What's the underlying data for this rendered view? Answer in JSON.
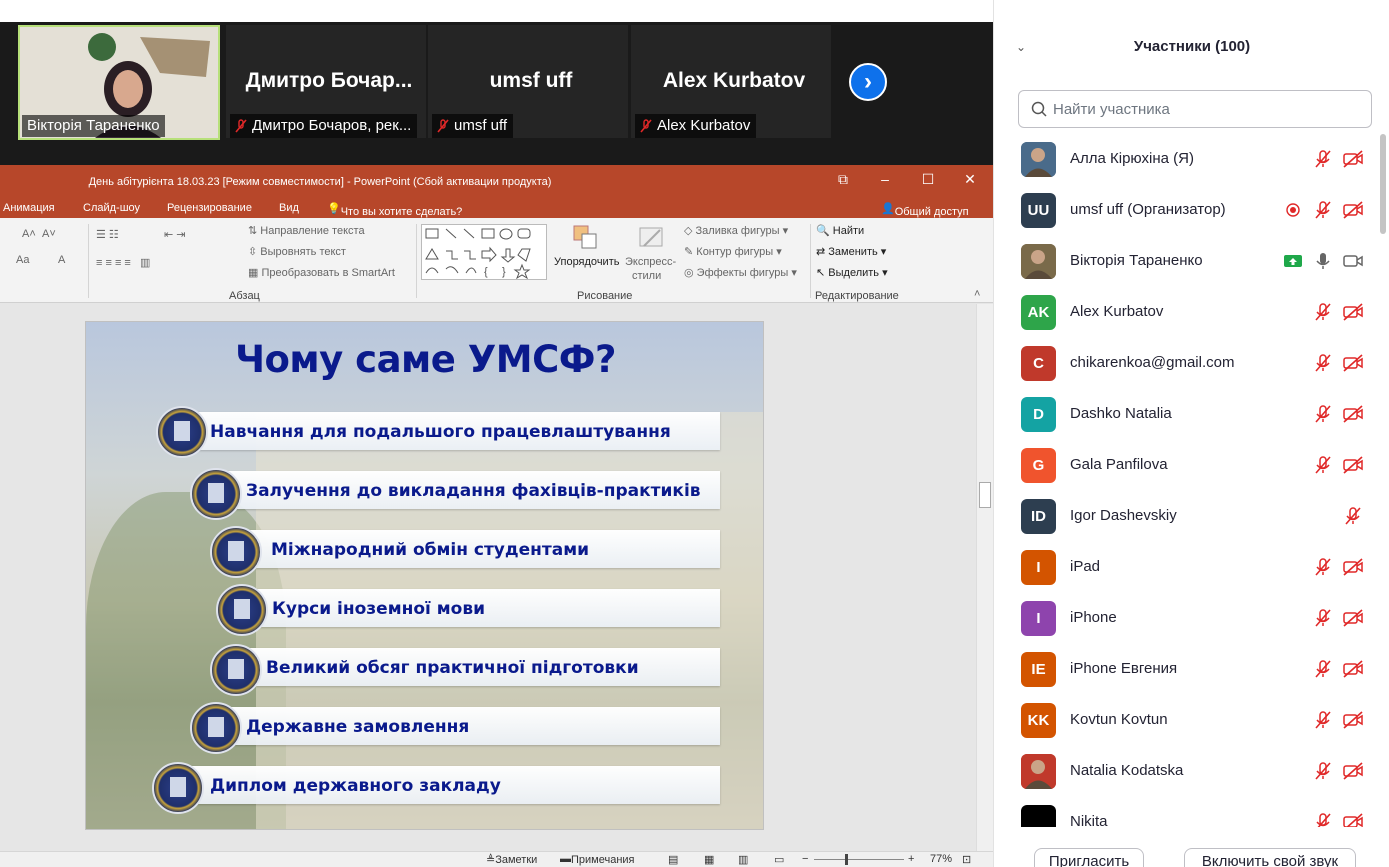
{
  "window": {
    "minimize": "—",
    "maximize": "☐",
    "close": "✕"
  },
  "zoom": {
    "self_label": "Вікторія Тараненко",
    "tiles": [
      {
        "name": "Дмитро Бочар...",
        "label": "Дмитро Бочаров, рек..."
      },
      {
        "name": "umsf uff",
        "label": "umsf uff"
      },
      {
        "name": "Alex Kurbatov",
        "label": "Alex Kurbatov"
      }
    ],
    "next_glyph": "›"
  },
  "ppt": {
    "title": "День абітурієнта 18.03.23 [Режим совместимости] - PowerPoint (Сбой активации продукта)",
    "tabs": [
      "Анимация",
      "Слайд-шоу",
      "Рецензирование",
      "Вид",
      "Что вы хотите сделать?",
      "Общий доступ"
    ],
    "ribbon": {
      "text_dir": "Направление текста",
      "align_text": "Выровнять текст",
      "smartart": "Преобразовать в SmartArt",
      "paragraph": "Абзац",
      "arrange": "Упорядочить",
      "quick_styles_1": "Экспресс-",
      "quick_styles_2": "стили",
      "fill": "Заливка фигуры",
      "outline": "Контур фигуры",
      "effects": "Эффекты фигуры",
      "drawing": "Рисование",
      "find": "Найти",
      "replace": "Заменить",
      "select": "Выделить",
      "editing": "Редактирование",
      "font_grow": "A˄",
      "font_shrink": "A˅",
      "case": "Aa",
      "font_color": "A"
    },
    "status": {
      "notes": "Заметки",
      "comments": "Примечания",
      "zoom": "77%",
      "minus": "−",
      "plus": "+"
    },
    "slide": {
      "title": "Чому саме УМСФ?",
      "bullets": [
        "Навчання для подальшого працевлаштування",
        "Залучення до викладання фахівців-практиків",
        "Міжнародний обмін студентами",
        "Курси іноземної мови",
        "Великий обсяг практичної підготовки",
        "Державне замовлення",
        "Диплом державного закладу"
      ]
    }
  },
  "participants": {
    "header": "Участники (100)",
    "search_placeholder": "Найти участника",
    "list": [
      {
        "name": "Алла Кірюхіна (Я)",
        "initials": "",
        "color": "#4a6b8a",
        "photo": true,
        "muted": true,
        "video_off": true
      },
      {
        "name": "umsf uff (Организатор)",
        "initials": "UU",
        "color": "#2d3e50",
        "photo": false,
        "muted": true,
        "video_off": true,
        "recording": true
      },
      {
        "name": "Вікторія Тараненко",
        "initials": "",
        "color": "#7a6a4a",
        "photo": true,
        "muted": false,
        "video_off": false,
        "sharing": true
      },
      {
        "name": "Alex Kurbatov",
        "initials": "AK",
        "color": "#2ea54a",
        "photo": false,
        "muted": true,
        "video_off": true
      },
      {
        "name": "chikarenkoa@gmail.com",
        "initials": "C",
        "color": "#c0392b",
        "photo": false,
        "muted": true,
        "video_off": true
      },
      {
        "name": "Dashko Natalia",
        "initials": "D",
        "color": "#14a3a3",
        "photo": false,
        "muted": true,
        "video_off": true
      },
      {
        "name": "Gala Panfilova",
        "initials": "G",
        "color": "#f0542d",
        "photo": false,
        "muted": true,
        "video_off": true
      },
      {
        "name": "Igor Dashevskiy",
        "initials": "ID",
        "color": "#2d3e50",
        "photo": false,
        "muted": true,
        "video_off": false,
        "no_video_icon": true
      },
      {
        "name": "iPad",
        "initials": "I",
        "color": "#d35400",
        "photo": false,
        "muted": true,
        "video_off": true
      },
      {
        "name": "iPhone",
        "initials": "I",
        "color": "#8e44ad",
        "photo": false,
        "muted": true,
        "video_off": true
      },
      {
        "name": "iPhone Евгения",
        "initials": "IE",
        "color": "#d35400",
        "photo": false,
        "muted": true,
        "video_off": true
      },
      {
        "name": "Kovtun Kovtun",
        "initials": "KK",
        "color": "#d35400",
        "photo": false,
        "muted": true,
        "video_off": true
      },
      {
        "name": "Natalia Kodatska",
        "initials": "",
        "color": "#c0392b",
        "photo": true,
        "muted": true,
        "video_off": true
      },
      {
        "name": "Nikita",
        "initials": "",
        "color": "#000000",
        "photo": false,
        "muted": true,
        "video_off": true
      }
    ],
    "invite_label": "Пригласить",
    "unmute_label": "Включить свой звук"
  },
  "colors": {
    "ppt_accent": "#b7472a",
    "zoom_blue": "#0e71eb",
    "muted_red": "#e02828",
    "slide_text": "#0a1a8c"
  }
}
